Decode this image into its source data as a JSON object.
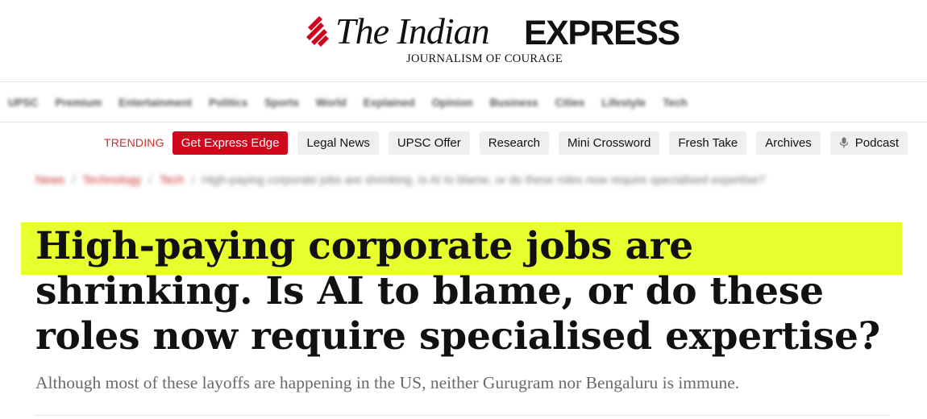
{
  "masthead": {
    "logo_the_indian": "The Indian",
    "logo_express": "EXPRESS",
    "tagline": "JOURNALISM OF COURAGE",
    "brand_color": "#d0061d"
  },
  "main_nav": {
    "items": [
      "UPSC",
      "Premium",
      "Entertainment",
      "Politics",
      "Sports",
      "World",
      "Explained",
      "Opinion",
      "Business",
      "Cities",
      "Lifestyle",
      "Tech"
    ]
  },
  "trending": {
    "label": "TRENDING",
    "items": [
      {
        "label": "Get Express Edge",
        "highlighted": true
      },
      {
        "label": "Legal News"
      },
      {
        "label": "UPSC Offer"
      },
      {
        "label": "Research"
      },
      {
        "label": "Mini Crossword"
      },
      {
        "label": "Fresh Take"
      },
      {
        "label": "Archives"
      },
      {
        "label": "Podcast",
        "icon": "microphone-icon"
      }
    ]
  },
  "breadcrumb": {
    "items": [
      "News",
      "Technology",
      "Tech"
    ],
    "current": "High-paying corporate jobs are shrinking. Is AI to blame, or do these roles now require specialised expertise?"
  },
  "article": {
    "headline": "High-paying corporate jobs are shrinking. Is AI to blame, or do these roles now require specialised expertise?",
    "subheadline": "Although most of these layoffs are happening in the US, neither Gurugram nor Bengaluru is immune.",
    "highlight_color": "#e8ff2e"
  }
}
